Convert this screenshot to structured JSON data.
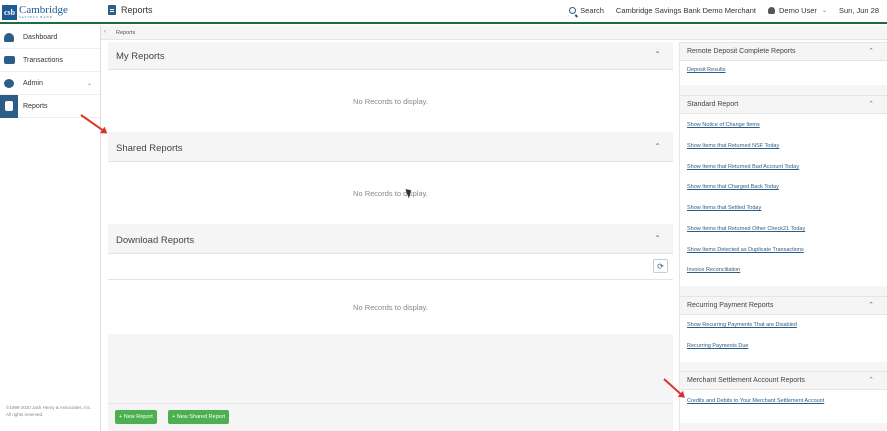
{
  "brand": {
    "logo_mark": "csb",
    "name": "Cambridge",
    "sub": "SAVINGS BANK"
  },
  "header": {
    "page_title": "Reports",
    "search_label": "Search",
    "merchant": "Cambridge Savings Bank Demo Merchant",
    "user": "Demo User",
    "date": "Sun, Jun 28",
    "accent_color": "#1f6b3b"
  },
  "sidebar": {
    "items": [
      {
        "label": "Dashboard",
        "icon": "dashboard-icon"
      },
      {
        "label": "Transactions",
        "icon": "transactions-icon"
      },
      {
        "label": "Admin",
        "icon": "admin-gears-icon"
      },
      {
        "label": "Reports",
        "icon": "reports-doc-icon",
        "active": true
      }
    ],
    "footer": "©1998-2020 Jack Henry & Associates, Inc. All rights reserved."
  },
  "breadcrumb": "Reports",
  "main": {
    "my_reports": {
      "title": "My Reports",
      "empty": "No Records to display."
    },
    "shared_reports": {
      "title": "Shared Reports",
      "empty": "No Records to display."
    },
    "download_reports": {
      "title": "Download Reports",
      "empty": "No Records to display."
    },
    "new_report_label": "+ New Report",
    "new_shared_report_label": "+ New Shared Report"
  },
  "right": {
    "remote_deposit": {
      "title": "Remote Deposit Complete Reports",
      "links": [
        "Deposit Results"
      ]
    },
    "standard": {
      "title": "Standard Report",
      "links": [
        "Show Notice of Change Items",
        "Show Items that Returned NSF Today",
        "Show Items that Returned Bad Account Today",
        "Show Items that Charged Back Today",
        "Show Items that Settled Today",
        "Show Items that Returned Other Check21 Today",
        "Show Items Detected as Duplicate Transactions",
        "Invoice Reconciliation"
      ]
    },
    "recurring": {
      "title": "Recurring Payment Reports",
      "links": [
        "Show Recurring Payments That are Disabled",
        "Recurring Payments Due"
      ]
    },
    "merchant_settlement": {
      "title": "Merchant Settlement Account Reports",
      "links": [
        "Credits and Debits to Your Merchant Settlement Account"
      ]
    }
  }
}
